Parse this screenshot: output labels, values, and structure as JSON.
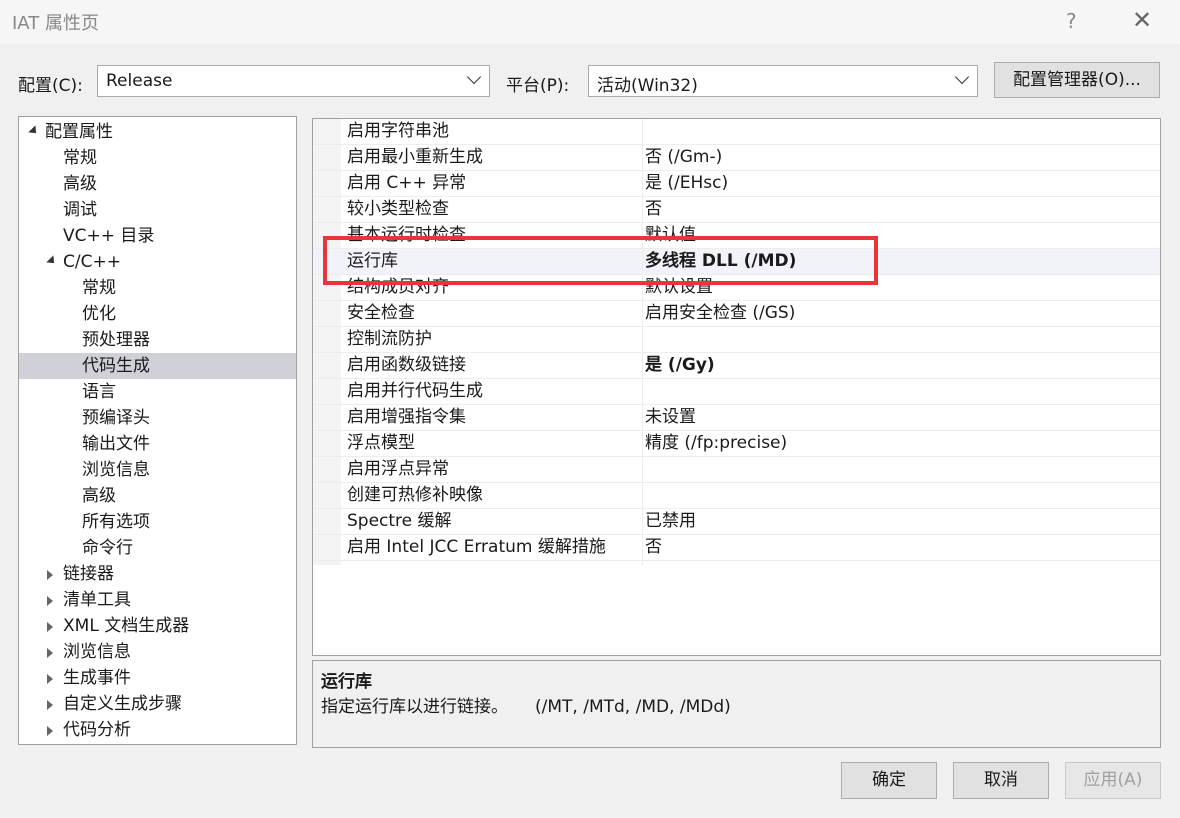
{
  "window": {
    "title": "IAT 属性页",
    "help_label": "?",
    "close_label": "✕"
  },
  "config": {
    "config_label": "配置(C):",
    "config_value": "Release",
    "platform_label": "平台(P):",
    "platform_value": "活动(Win32)",
    "manager_button": "配置管理器(O)..."
  },
  "tree": [
    {
      "label": "配置属性",
      "level": 0,
      "expander": "expanded"
    },
    {
      "label": "常规",
      "level": 1,
      "expander": "none"
    },
    {
      "label": "高级",
      "level": 1,
      "expander": "none"
    },
    {
      "label": "调试",
      "level": 1,
      "expander": "none"
    },
    {
      "label": "VC++ 目录",
      "level": 1,
      "expander": "none"
    },
    {
      "label": "C/C++",
      "level": 1,
      "expander": "expanded"
    },
    {
      "label": "常规",
      "level": 2,
      "expander": "none"
    },
    {
      "label": "优化",
      "level": 2,
      "expander": "none"
    },
    {
      "label": "预处理器",
      "level": 2,
      "expander": "none"
    },
    {
      "label": "代码生成",
      "level": 2,
      "expander": "none",
      "selected": true
    },
    {
      "label": "语言",
      "level": 2,
      "expander": "none"
    },
    {
      "label": "预编译头",
      "level": 2,
      "expander": "none"
    },
    {
      "label": "输出文件",
      "level": 2,
      "expander": "none"
    },
    {
      "label": "浏览信息",
      "level": 2,
      "expander": "none"
    },
    {
      "label": "高级",
      "level": 2,
      "expander": "none"
    },
    {
      "label": "所有选项",
      "level": 2,
      "expander": "none"
    },
    {
      "label": "命令行",
      "level": 2,
      "expander": "none"
    },
    {
      "label": "链接器",
      "level": 1,
      "expander": "collapsed"
    },
    {
      "label": "清单工具",
      "level": 1,
      "expander": "collapsed"
    },
    {
      "label": "XML 文档生成器",
      "level": 1,
      "expander": "collapsed"
    },
    {
      "label": "浏览信息",
      "level": 1,
      "expander": "collapsed"
    },
    {
      "label": "生成事件",
      "level": 1,
      "expander": "collapsed"
    },
    {
      "label": "自定义生成步骤",
      "level": 1,
      "expander": "collapsed"
    },
    {
      "label": "代码分析",
      "level": 1,
      "expander": "collapsed"
    }
  ],
  "properties": [
    {
      "name": "启用字符串池",
      "value": "",
      "bold": false
    },
    {
      "name": "启用最小重新生成",
      "value": "否 (/Gm-)",
      "bold": false
    },
    {
      "name": "启用 C++ 异常",
      "value": "是 (/EHsc)",
      "bold": false
    },
    {
      "name": "较小类型检查",
      "value": "否",
      "bold": false
    },
    {
      "name": "基本运行时检查",
      "value": "默认值",
      "bold": false
    },
    {
      "name": "运行库",
      "value": "多线程 DLL (/MD)",
      "bold": true,
      "selected": true
    },
    {
      "name": "结构成员对齐",
      "value": "默认设置",
      "bold": false
    },
    {
      "name": "安全检查",
      "value": "启用安全检查 (/GS)",
      "bold": false
    },
    {
      "name": "控制流防护",
      "value": "",
      "bold": false
    },
    {
      "name": "启用函数级链接",
      "value": "是 (/Gy)",
      "bold": true
    },
    {
      "name": "启用并行代码生成",
      "value": "",
      "bold": false
    },
    {
      "name": "启用增强指令集",
      "value": "未设置",
      "bold": false
    },
    {
      "name": "浮点模型",
      "value": "精度 (/fp:precise)",
      "bold": false
    },
    {
      "name": "启用浮点异常",
      "value": "",
      "bold": false
    },
    {
      "name": "创建可热修补映像",
      "value": "",
      "bold": false
    },
    {
      "name": "Spectre 缓解",
      "value": "已禁用",
      "bold": false
    },
    {
      "name": "启用 Intel JCC Erratum 缓解措施",
      "value": "否",
      "bold": false
    }
  ],
  "description": {
    "title": "运行库",
    "text": "指定运行库以进行链接。     (/MT, /MTd, /MD, /MDd)"
  },
  "buttons": {
    "ok": "确定",
    "cancel": "取消",
    "apply": "应用(A)"
  },
  "colors": {
    "highlight_border": "#e8353a",
    "tree_selection": "#cfd0d8"
  }
}
